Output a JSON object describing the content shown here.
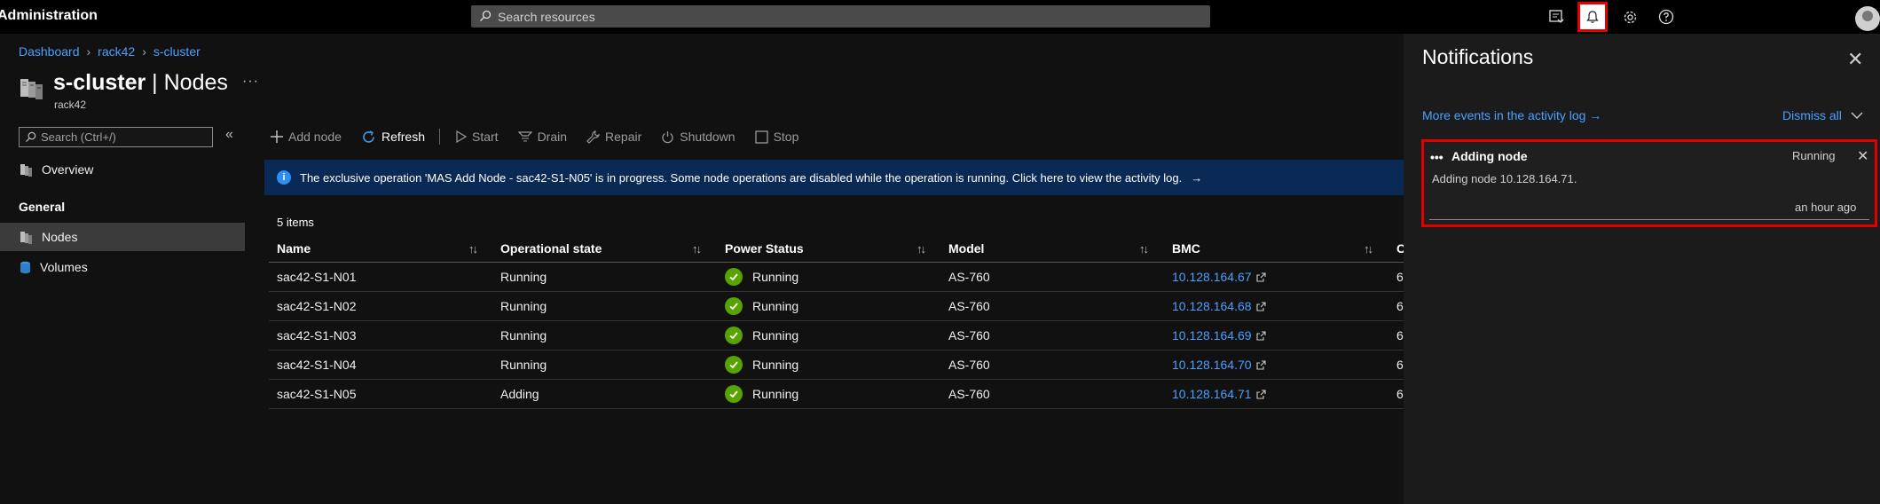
{
  "topbar": {
    "app_title": "Administration",
    "search_placeholder": "Search resources"
  },
  "breadcrumb": [
    "Dashboard",
    "rack42",
    "s-cluster"
  ],
  "page": {
    "title_resource": "s-cluster",
    "title_separator": " | ",
    "title_section": "Nodes",
    "subtitle": "rack42",
    "more": "···"
  },
  "sidebar": {
    "search_placeholder": "Search (Ctrl+/)",
    "collapse": "«",
    "overview": "Overview",
    "group_general": "General",
    "nodes": "Nodes",
    "volumes": "Volumes"
  },
  "toolbar": {
    "add_node": "Add node",
    "refresh": "Refresh",
    "start": "Start",
    "drain": "Drain",
    "repair": "Repair",
    "shutdown": "Shutdown",
    "stop": "Stop"
  },
  "banner": {
    "text": "The exclusive operation 'MAS Add Node - sac42-S1-N05' is in progress. Some node operations are disabled while the operation is running. Click here to view the activity log.",
    "arrow": "→"
  },
  "table": {
    "items_count": "5 items",
    "columns": [
      "Name",
      "Operational state",
      "Power Status",
      "Model",
      "BMC",
      "C"
    ],
    "rows": [
      {
        "name": "sac42-S1-N01",
        "state": "Running",
        "power": "Running",
        "model": "AS-760",
        "bmc": "10.128.164.67",
        "c": "6"
      },
      {
        "name": "sac42-S1-N02",
        "state": "Running",
        "power": "Running",
        "model": "AS-760",
        "bmc": "10.128.164.68",
        "c": "6"
      },
      {
        "name": "sac42-S1-N03",
        "state": "Running",
        "power": "Running",
        "model": "AS-760",
        "bmc": "10.128.164.69",
        "c": "6"
      },
      {
        "name": "sac42-S1-N04",
        "state": "Running",
        "power": "Running",
        "model": "AS-760",
        "bmc": "10.128.164.70",
        "c": "6"
      },
      {
        "name": "sac42-S1-N05",
        "state": "Adding",
        "power": "Running",
        "model": "AS-760",
        "bmc": "10.128.164.71",
        "c": "6"
      }
    ]
  },
  "notifications": {
    "title": "Notifications",
    "activity_link": "More events in the activity log →",
    "dismiss_all": "Dismiss all",
    "card": {
      "dots": "•••",
      "title": "Adding node",
      "status": "Running",
      "description": "Adding node 10.128.164.71.",
      "time": "an hour ago"
    }
  },
  "colors": {
    "accent_link": "#4aa0ff",
    "banner_bg": "#0a2a55",
    "success": "#57a300",
    "highlight": "#e00000"
  }
}
